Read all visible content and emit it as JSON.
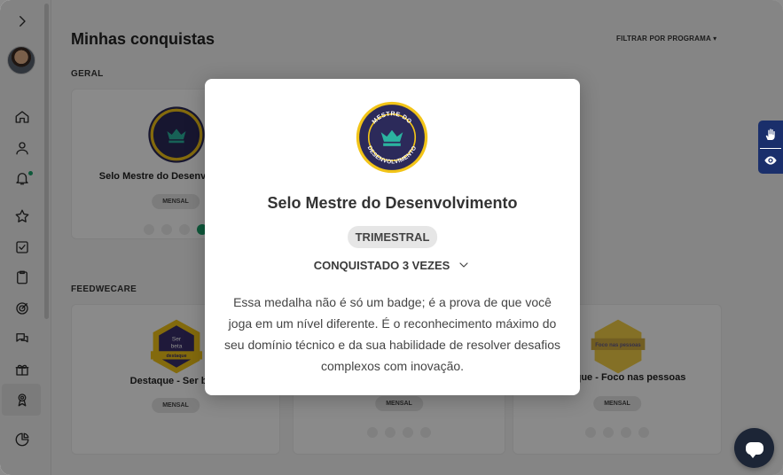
{
  "sidebar": {
    "items": [
      {
        "name": "expand-icon"
      },
      {
        "name": "avatar"
      },
      {
        "name": "home-icon"
      },
      {
        "name": "user-icon"
      },
      {
        "name": "bell-icon"
      },
      {
        "name": "star-icon"
      },
      {
        "name": "checkbox-icon"
      },
      {
        "name": "clipboard-icon"
      },
      {
        "name": "target-icon"
      },
      {
        "name": "chat-icon"
      },
      {
        "name": "gift-icon"
      },
      {
        "name": "medal-icon",
        "active": true
      },
      {
        "name": "pie-chart-icon"
      }
    ]
  },
  "main": {
    "title": "Minhas conquistas",
    "filter_label": "FILTRAR POR PROGRAMA",
    "sections": [
      {
        "label": "GERAL",
        "cards": [
          {
            "title": "Selo Mestre do Desenvolvimento",
            "pill": "MENSAL"
          }
        ]
      },
      {
        "label": "FEEDWECARE",
        "cards": [
          {
            "title": "Destaque - Ser beta",
            "pill": "MENSAL"
          },
          {
            "title": "",
            "pill": "MENSAL"
          },
          {
            "title": "Destaque - Foco nas pessoas",
            "pill": "MENSAL"
          }
        ]
      }
    ]
  },
  "modal": {
    "medal_text_top": "MESTRE DO",
    "medal_text_bottom": "DESENVOLVIMENTO",
    "title": "Selo Mestre do Desenvolvimento",
    "pill": "TRIMESTRAL",
    "count_label": "CONQUISTADO 3 VEZES",
    "description": "Essa medalha não é só um badge; é a prova de que você joga em um nível diferente. É o reconhecimento máximo do seu domínio técnico e da sua habilidade de resolver desafios complexos com inovação."
  },
  "badges": {
    "beta_top": "Ser",
    "beta_mid": "beta",
    "beta_banner": "destaque",
    "people_text": "Foco nas pessoas"
  },
  "colors": {
    "medal_navy": "#2c2a5a",
    "medal_gold": "#f2c418",
    "medal_teal": "#2bb3a0",
    "accent_green": "#1aa36b",
    "a11y_blue": "#1a2f6b",
    "chat_dark": "#1c2536"
  }
}
